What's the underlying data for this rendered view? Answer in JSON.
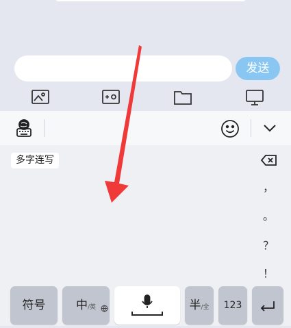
{
  "chat": {
    "input_value": "",
    "send_label": "发送"
  },
  "icons": {
    "tools": [
      "image-icon",
      "camera-icon",
      "folder-icon",
      "screen-share-icon"
    ],
    "keyboard_settings": "keyboard-settings-icon",
    "emoji": "emoji-icon",
    "hide_keyboard": "chevron-down-icon",
    "backspace": "backspace-icon",
    "microphone": "microphone-icon",
    "language": "globe-icon"
  },
  "keyboard": {
    "candidate_chip": "多字连写",
    "punctuation": [
      "，",
      "。",
      "？",
      "！"
    ],
    "keys": {
      "symbols": "符号",
      "chinese": "中",
      "chinese_sub": "/英",
      "half_width": "半",
      "half_width_sub": "/全",
      "numbers": "123"
    }
  },
  "colors": {
    "send_button": "#89c7f2",
    "arrow": "#f03a3a",
    "dark_key": "#c1c5cf"
  }
}
